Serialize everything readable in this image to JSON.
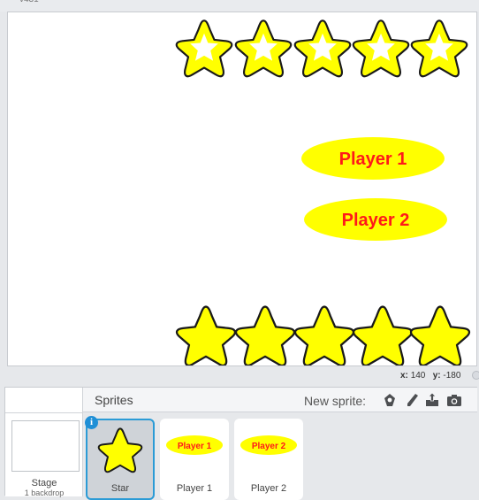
{
  "top_fragment": "v431",
  "stage": {
    "player_labels": [
      "Player 1",
      "Player 2"
    ],
    "star_rows": 2,
    "stars_per_row": 5,
    "colors": {
      "star_fill": "#ffff00",
      "star_outline": "#1a1a1a",
      "pill_fill": "#ffff00",
      "pill_text": "#ff1a1a"
    }
  },
  "mouse": {
    "x_label": "x:",
    "x": "140",
    "y_label": "y:",
    "y": "-180"
  },
  "stage_panel": {
    "label": "Stage",
    "sub": "1 backdrop"
  },
  "sprites_panel": {
    "title": "Sprites",
    "new_sprite_label": "New sprite:",
    "new_sprite_icons": [
      "choose-from-library-icon",
      "paint-new-sprite-icon",
      "upload-sprite-icon",
      "camera-icon"
    ]
  },
  "sprites": [
    {
      "name": "Star",
      "selected": true,
      "thumb": "star"
    },
    {
      "name": "Player 1",
      "selected": false,
      "thumb_text": "Player 1"
    },
    {
      "name": "Player 2",
      "selected": false,
      "thumb_text": "Player 2"
    }
  ],
  "info_glyph": "i",
  "accent": "#2b9bd6"
}
